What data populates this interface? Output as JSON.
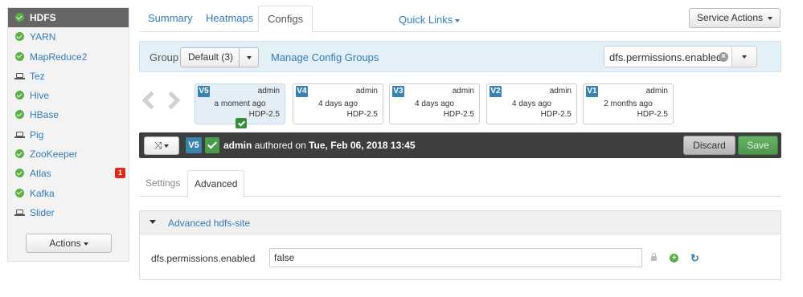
{
  "sidebar": {
    "services": [
      {
        "name": "HDFS",
        "status": "ok",
        "active": true
      },
      {
        "name": "YARN",
        "status": "ok"
      },
      {
        "name": "MapReduce2",
        "status": "ok"
      },
      {
        "name": "Tez",
        "status": "client"
      },
      {
        "name": "Hive",
        "status": "ok"
      },
      {
        "name": "HBase",
        "status": "ok"
      },
      {
        "name": "Pig",
        "status": "client"
      },
      {
        "name": "ZooKeeper",
        "status": "ok"
      },
      {
        "name": "Atlas",
        "status": "ok",
        "alerts": "1"
      },
      {
        "name": "Kafka",
        "status": "ok"
      },
      {
        "name": "Slider",
        "status": "client"
      }
    ],
    "actions_label": "Actions"
  },
  "tabs": {
    "summary": "Summary",
    "heatmaps": "Heatmaps",
    "configs": "Configs",
    "quick_links": "Quick Links",
    "service_actions": "Service Actions"
  },
  "group_bar": {
    "label": "Group",
    "selected": "Default (3)",
    "manage_link": "Manage Config Groups",
    "filter_value": "dfs.permissions.enabled"
  },
  "versions": [
    {
      "tag": "V5",
      "author": "admin",
      "when": "a moment ago",
      "stack": "HDP-2.5",
      "current": true
    },
    {
      "tag": "V4",
      "author": "admin",
      "when": "4 days ago",
      "stack": "HDP-2.5"
    },
    {
      "tag": "V3",
      "author": "admin",
      "when": "4 days ago",
      "stack": "HDP-2.5"
    },
    {
      "tag": "V2",
      "author": "admin",
      "when": "4 days ago",
      "stack": "HDP-2.5"
    },
    {
      "tag": "V1",
      "author": "admin",
      "when": "2 months ago",
      "stack": "HDP-2.5"
    }
  ],
  "current_bar": {
    "tag": "V5",
    "author": "admin",
    "authored_text": "authored on",
    "date": "Tue, Feb 06, 2018 13:45",
    "discard_label": "Discard",
    "save_label": "Save"
  },
  "subtabs": {
    "settings": "Settings",
    "advanced": "Advanced"
  },
  "advanced_panel": {
    "title": "Advanced hdfs-site",
    "property_name": "dfs.permissions.enabled",
    "property_value": "false"
  },
  "colors": {
    "link": "#337ab7",
    "ok_status": "#5ab043",
    "version_tag": "#3a83b0",
    "dark_bar": "#3e3e3e",
    "save_button": "#4a974a",
    "alert_badge": "#e1261c"
  }
}
